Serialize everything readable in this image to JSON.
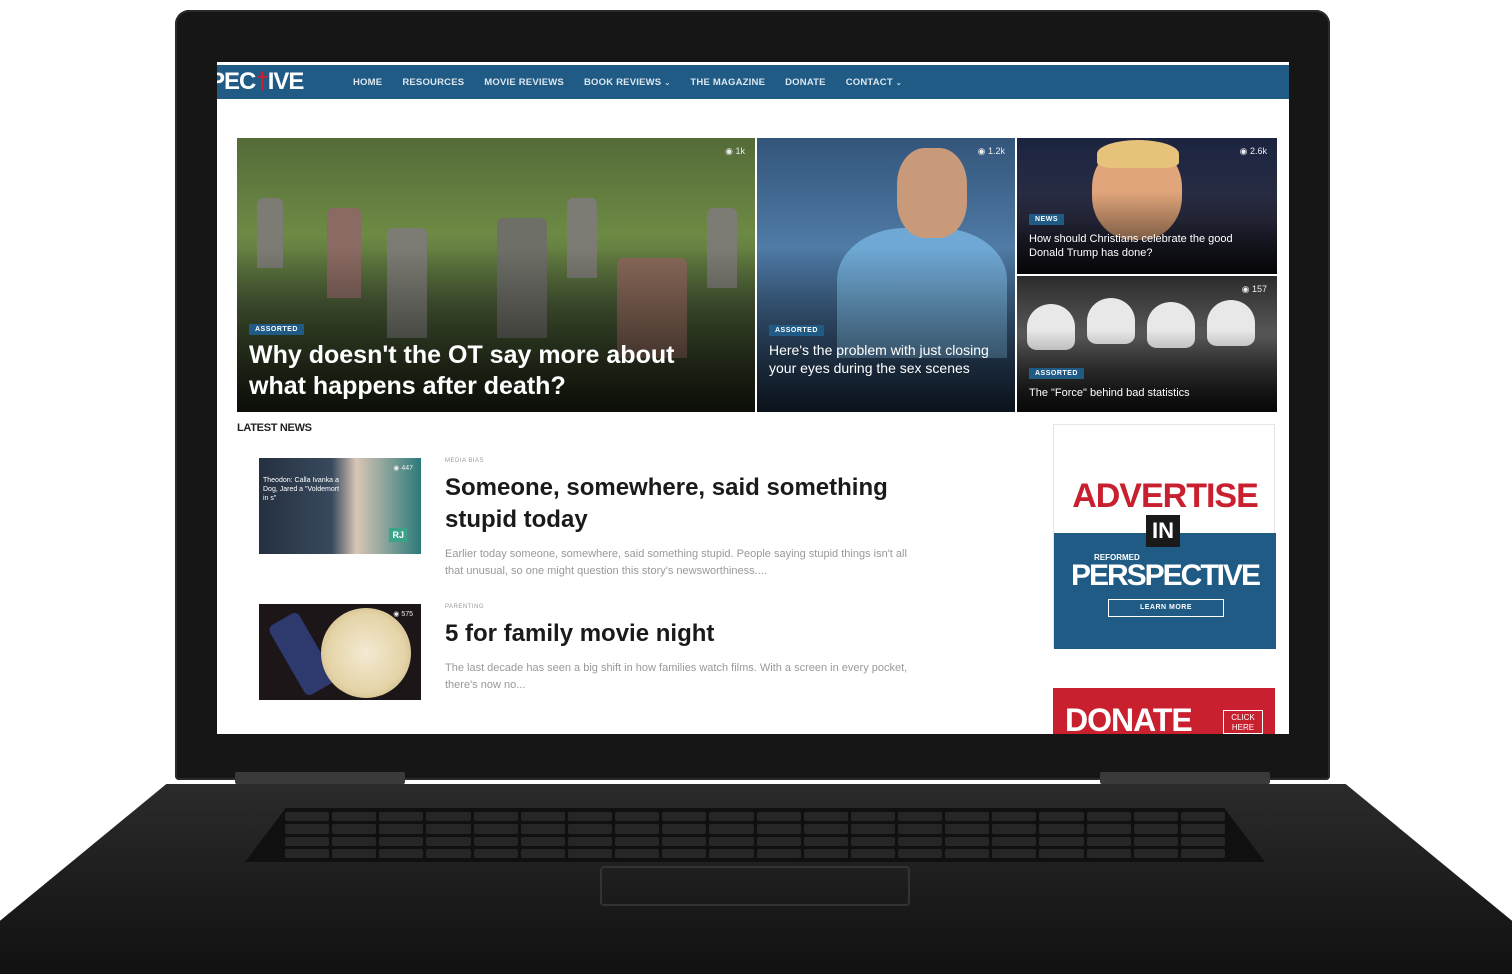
{
  "nav": {
    "logo_text": "PECTIVE",
    "items": [
      {
        "label": "HOME"
      },
      {
        "label": "RESOURCES"
      },
      {
        "label": "MOVIE REVIEWS"
      },
      {
        "label": "BOOK REVIEWS",
        "caret": "⌄"
      },
      {
        "label": "THE MAGAZINE"
      },
      {
        "label": "DONATE"
      },
      {
        "label": "CONTACT",
        "caret": "⌄"
      }
    ]
  },
  "hero": {
    "main": {
      "badge": "ASSORTED",
      "headline": "Why doesn't the OT say more about what happens after death?",
      "views": "1k"
    },
    "second": {
      "badge": "ASSORTED",
      "headline": "Here's the problem with just closing your eyes during the sex scenes",
      "views": "1.2k"
    },
    "third": {
      "badge": "NEWS",
      "headline": "How should Christians celebrate the good Donald Trump has done?",
      "views": "2.6k"
    },
    "fourth": {
      "badge": "ASSORTED",
      "headline": "The \"Force\" behind bad statistics",
      "views": "157"
    }
  },
  "latest": {
    "title": "LATEST NEWS",
    "articles": [
      {
        "category": "MEDIA BIAS",
        "title": "Someone, somewhere, said something stupid today",
        "excerpt": "Earlier today someone, somewhere, said something stupid. People saying stupid things isn't all that unusual, so one might question this story's newsworthiness....",
        "views": "447",
        "thumb_text": "Theodon: Calla Ivanka a Dog, Jared a \"Voldemort in s\"",
        "thumb_badge": "RJ"
      },
      {
        "category": "PARENTING",
        "title": "5 for family movie night",
        "excerpt": "The last decade has seen a big shift in how families watch films. With a screen in every pocket, there's now no...",
        "views": "575"
      }
    ]
  },
  "sidebar": {
    "advertise": {
      "word": "ADVERTISE",
      "in": "IN",
      "reformed": "REFORMED",
      "brand": "PERSPECTIVE",
      "cta": "LEARN MORE"
    },
    "donate": {
      "word": "DONATE",
      "cta_line1": "CLICK",
      "cta_line2": "HERE"
    }
  },
  "colors": {
    "nav": "#1f5b85",
    "accent_red": "#c8202f",
    "badge": "#1f5b85"
  }
}
